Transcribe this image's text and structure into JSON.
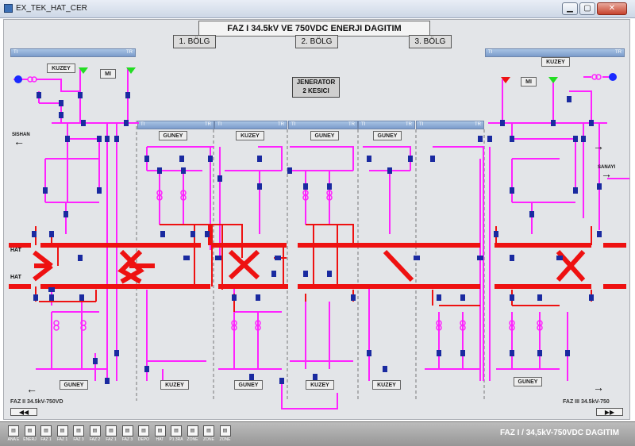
{
  "window": {
    "title": "EX_TEK_HAT_CER"
  },
  "header": {
    "title": "FAZ I 34.5kV VE 750VDC ENERJI DAGITIM",
    "sections": [
      "1. BÖLG",
      "2. BÖLG",
      "3. BÖLG"
    ]
  },
  "generator_button": {
    "line1": "JENERATOR",
    "line2": "2 KESICI"
  },
  "labels": {
    "kuzey": "KUZEY",
    "guney": "GUNEY",
    "mi": "MI",
    "hat": "HAT",
    "sishan": "SISHAN",
    "sanayi": "SANAYI",
    "ti": "TI",
    "tr": "TR"
  },
  "footer": {
    "left": "FAZ II 34.5kV-750VD",
    "right": "FAZ III 34.5kV-750"
  },
  "taskbar": {
    "title": "FAZ I / 34,5kV-750VDC DAGITIM",
    "buttons": [
      "ANA E",
      "ENERJ",
      "FAZ 1",
      "FAZ 1",
      "FAZ 3",
      "FAZ 2",
      "FAZ 1",
      "FAZ 3",
      "DEPO",
      "HAT",
      "P1 3RA",
      "ZONE",
      "ZONE",
      "ZONE"
    ]
  },
  "colors": {
    "feeder": "#ff22ff",
    "busbar": "#ee1111",
    "breaker": "#1a2aa0",
    "green_flag": "#22dd22",
    "red_flag": "#ee1111",
    "generator": "#1a2aff"
  }
}
